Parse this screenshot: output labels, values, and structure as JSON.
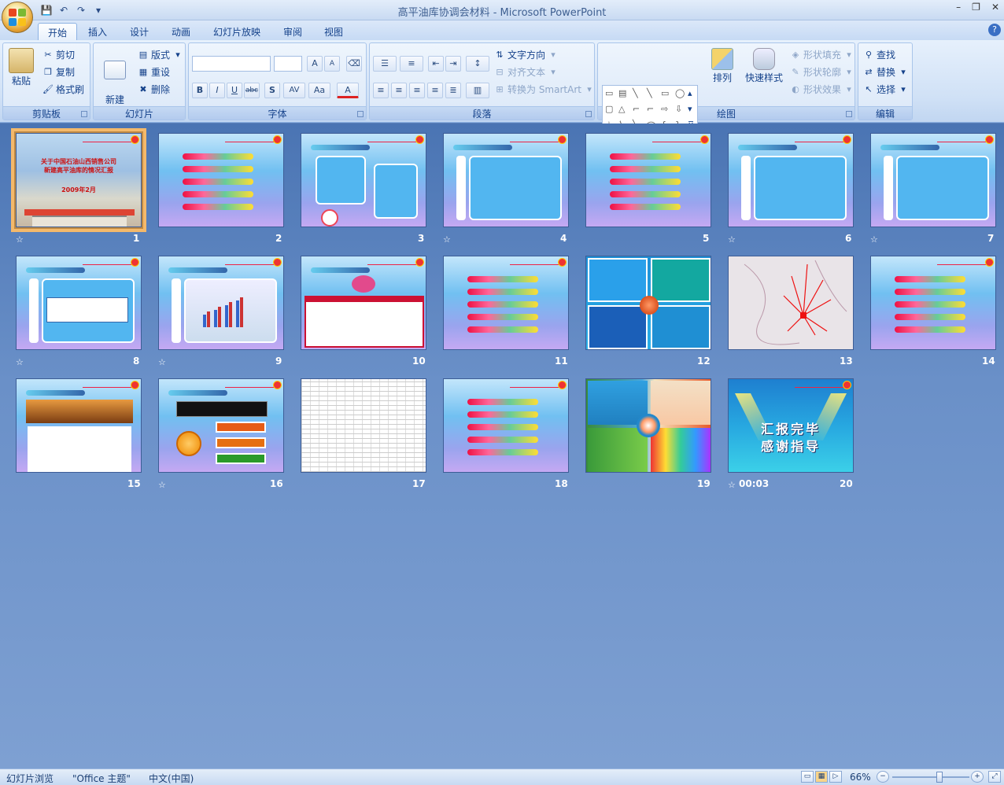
{
  "window": {
    "title": "高平油库协调会材料 - Microsoft PowerPoint",
    "min": "–",
    "max": "❐",
    "close": "✕"
  },
  "qat": {
    "save": "💾",
    "undo": "↶",
    "redo": "↷",
    "more": "▾"
  },
  "tabs": [
    "开始",
    "插入",
    "设计",
    "动画",
    "幻灯片放映",
    "审阅",
    "视图"
  ],
  "help": "?",
  "ribbon": {
    "clipboard": {
      "label": "剪贴板",
      "paste": "粘贴",
      "cut": "剪切",
      "copy": "复制",
      "format_painter": "格式刷"
    },
    "slides": {
      "label": "幻灯片",
      "new_slide": "新建\n幻灯片",
      "layout": "版式",
      "reset": "重设",
      "delete": "删除"
    },
    "font": {
      "label": "字体",
      "bold": "B",
      "italic": "I",
      "underline": "U",
      "strike": "abc",
      "shadow": "S",
      "spacing": "AV",
      "case": "Aa",
      "color": "A",
      "grow": "A",
      "shrink": "A"
    },
    "paragraph": {
      "label": "段落",
      "text_direction": "文字方向",
      "align_text": "对齐文本",
      "smartart": "转换为 SmartArt"
    },
    "drawing": {
      "label": "绘图",
      "arrange": "排列",
      "quick_styles": "快速样式",
      "shape_fill": "形状填充",
      "shape_outline": "形状轮廓",
      "shape_effects": "形状效果"
    },
    "editing": {
      "label": "编辑",
      "find": "查找",
      "replace": "替换",
      "select": "选择"
    }
  },
  "slides": [
    {
      "num": "1",
      "star": "☆",
      "title1": "关于中国石油山西销售公司",
      "title2": "新建高平油库的情况汇报",
      "date": "2009年2月"
    },
    {
      "num": "2"
    },
    {
      "num": "3"
    },
    {
      "num": "4",
      "star": "☆"
    },
    {
      "num": "5"
    },
    {
      "num": "6",
      "star": "☆"
    },
    {
      "num": "7",
      "star": "☆"
    },
    {
      "num": "8",
      "star": "☆"
    },
    {
      "num": "9",
      "star": "☆"
    },
    {
      "num": "10"
    },
    {
      "num": "11"
    },
    {
      "num": "12"
    },
    {
      "num": "13"
    },
    {
      "num": "14"
    },
    {
      "num": "15"
    },
    {
      "num": "16",
      "star": "☆"
    },
    {
      "num": "17"
    },
    {
      "num": "18"
    },
    {
      "num": "19"
    },
    {
      "num": "20",
      "star": "☆",
      "time": "00:03",
      "line1": "汇报完毕",
      "line2": "感谢指导"
    }
  ],
  "status": {
    "view": "幻灯片浏览",
    "theme": "\"Office 主题\"",
    "lang": "中文(中国)",
    "zoom": "66%",
    "zoom_out": "−",
    "zoom_in": "+"
  }
}
